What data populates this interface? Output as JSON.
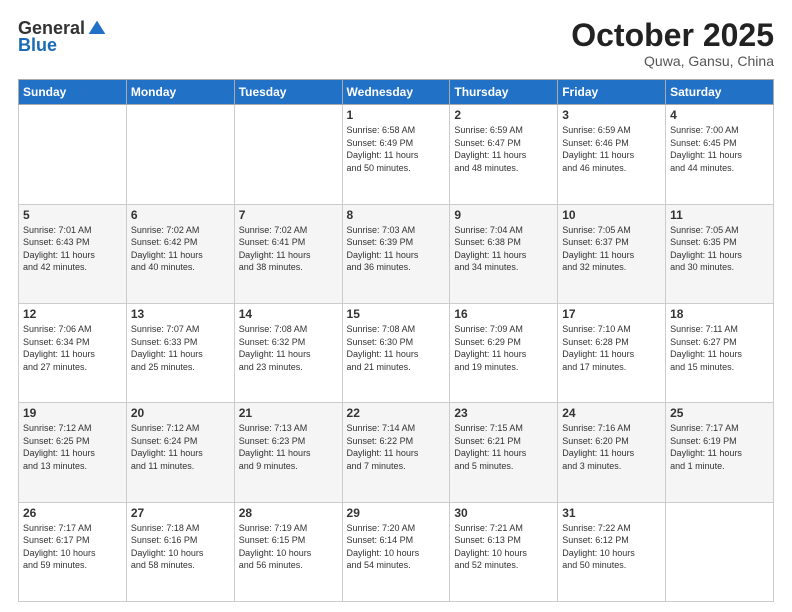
{
  "logo": {
    "general": "General",
    "blue": "Blue"
  },
  "header": {
    "month": "October 2025",
    "location": "Quwa, Gansu, China"
  },
  "weekdays": [
    "Sunday",
    "Monday",
    "Tuesday",
    "Wednesday",
    "Thursday",
    "Friday",
    "Saturday"
  ],
  "weeks": [
    [
      {
        "day": "",
        "info": ""
      },
      {
        "day": "",
        "info": ""
      },
      {
        "day": "",
        "info": ""
      },
      {
        "day": "1",
        "info": "Sunrise: 6:58 AM\nSunset: 6:49 PM\nDaylight: 11 hours\nand 50 minutes."
      },
      {
        "day": "2",
        "info": "Sunrise: 6:59 AM\nSunset: 6:47 PM\nDaylight: 11 hours\nand 48 minutes."
      },
      {
        "day": "3",
        "info": "Sunrise: 6:59 AM\nSunset: 6:46 PM\nDaylight: 11 hours\nand 46 minutes."
      },
      {
        "day": "4",
        "info": "Sunrise: 7:00 AM\nSunset: 6:45 PM\nDaylight: 11 hours\nand 44 minutes."
      }
    ],
    [
      {
        "day": "5",
        "info": "Sunrise: 7:01 AM\nSunset: 6:43 PM\nDaylight: 11 hours\nand 42 minutes."
      },
      {
        "day": "6",
        "info": "Sunrise: 7:02 AM\nSunset: 6:42 PM\nDaylight: 11 hours\nand 40 minutes."
      },
      {
        "day": "7",
        "info": "Sunrise: 7:02 AM\nSunset: 6:41 PM\nDaylight: 11 hours\nand 38 minutes."
      },
      {
        "day": "8",
        "info": "Sunrise: 7:03 AM\nSunset: 6:39 PM\nDaylight: 11 hours\nand 36 minutes."
      },
      {
        "day": "9",
        "info": "Sunrise: 7:04 AM\nSunset: 6:38 PM\nDaylight: 11 hours\nand 34 minutes."
      },
      {
        "day": "10",
        "info": "Sunrise: 7:05 AM\nSunset: 6:37 PM\nDaylight: 11 hours\nand 32 minutes."
      },
      {
        "day": "11",
        "info": "Sunrise: 7:05 AM\nSunset: 6:35 PM\nDaylight: 11 hours\nand 30 minutes."
      }
    ],
    [
      {
        "day": "12",
        "info": "Sunrise: 7:06 AM\nSunset: 6:34 PM\nDaylight: 11 hours\nand 27 minutes."
      },
      {
        "day": "13",
        "info": "Sunrise: 7:07 AM\nSunset: 6:33 PM\nDaylight: 11 hours\nand 25 minutes."
      },
      {
        "day": "14",
        "info": "Sunrise: 7:08 AM\nSunset: 6:32 PM\nDaylight: 11 hours\nand 23 minutes."
      },
      {
        "day": "15",
        "info": "Sunrise: 7:08 AM\nSunset: 6:30 PM\nDaylight: 11 hours\nand 21 minutes."
      },
      {
        "day": "16",
        "info": "Sunrise: 7:09 AM\nSunset: 6:29 PM\nDaylight: 11 hours\nand 19 minutes."
      },
      {
        "day": "17",
        "info": "Sunrise: 7:10 AM\nSunset: 6:28 PM\nDaylight: 11 hours\nand 17 minutes."
      },
      {
        "day": "18",
        "info": "Sunrise: 7:11 AM\nSunset: 6:27 PM\nDaylight: 11 hours\nand 15 minutes."
      }
    ],
    [
      {
        "day": "19",
        "info": "Sunrise: 7:12 AM\nSunset: 6:25 PM\nDaylight: 11 hours\nand 13 minutes."
      },
      {
        "day": "20",
        "info": "Sunrise: 7:12 AM\nSunset: 6:24 PM\nDaylight: 11 hours\nand 11 minutes."
      },
      {
        "day": "21",
        "info": "Sunrise: 7:13 AM\nSunset: 6:23 PM\nDaylight: 11 hours\nand 9 minutes."
      },
      {
        "day": "22",
        "info": "Sunrise: 7:14 AM\nSunset: 6:22 PM\nDaylight: 11 hours\nand 7 minutes."
      },
      {
        "day": "23",
        "info": "Sunrise: 7:15 AM\nSunset: 6:21 PM\nDaylight: 11 hours\nand 5 minutes."
      },
      {
        "day": "24",
        "info": "Sunrise: 7:16 AM\nSunset: 6:20 PM\nDaylight: 11 hours\nand 3 minutes."
      },
      {
        "day": "25",
        "info": "Sunrise: 7:17 AM\nSunset: 6:19 PM\nDaylight: 11 hours\nand 1 minute."
      }
    ],
    [
      {
        "day": "26",
        "info": "Sunrise: 7:17 AM\nSunset: 6:17 PM\nDaylight: 10 hours\nand 59 minutes."
      },
      {
        "day": "27",
        "info": "Sunrise: 7:18 AM\nSunset: 6:16 PM\nDaylight: 10 hours\nand 58 minutes."
      },
      {
        "day": "28",
        "info": "Sunrise: 7:19 AM\nSunset: 6:15 PM\nDaylight: 10 hours\nand 56 minutes."
      },
      {
        "day": "29",
        "info": "Sunrise: 7:20 AM\nSunset: 6:14 PM\nDaylight: 10 hours\nand 54 minutes."
      },
      {
        "day": "30",
        "info": "Sunrise: 7:21 AM\nSunset: 6:13 PM\nDaylight: 10 hours\nand 52 minutes."
      },
      {
        "day": "31",
        "info": "Sunrise: 7:22 AM\nSunset: 6:12 PM\nDaylight: 10 hours\nand 50 minutes."
      },
      {
        "day": "",
        "info": ""
      }
    ]
  ]
}
